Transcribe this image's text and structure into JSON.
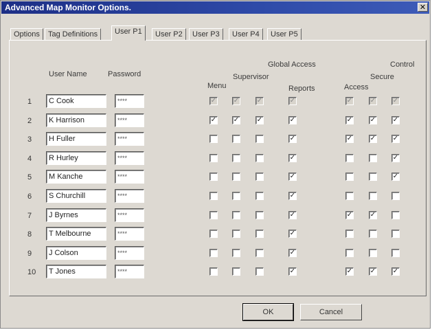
{
  "window": {
    "title": "Advanced Map Monitor Options."
  },
  "tabs": [
    "Options",
    "Tag Definitions",
    "User P1",
    "User P2",
    "User P3",
    "User P4",
    "User P5"
  ],
  "active_tab": "User P1",
  "headers": {
    "user_name": "User Name",
    "password": "Password",
    "global_access": "Global Access",
    "supervisor": "Supervisor",
    "menu": "Menu",
    "reports": "Reports",
    "control": "Control",
    "secure": "Secure",
    "access": "Access"
  },
  "rows": [
    {
      "num": "1",
      "name": "C Cook",
      "password": "****",
      "checks": [
        1,
        1,
        1,
        1,
        1,
        1,
        1
      ],
      "disabled": true
    },
    {
      "num": "2",
      "name": "K Harrison",
      "password": "****",
      "checks": [
        1,
        1,
        1,
        1,
        1,
        1,
        1
      ],
      "disabled": false
    },
    {
      "num": "3",
      "name": "H Fuller",
      "password": "****",
      "checks": [
        0,
        0,
        0,
        1,
        1,
        1,
        1
      ],
      "disabled": false
    },
    {
      "num": "4",
      "name": "R Hurley",
      "password": "****",
      "checks": [
        0,
        0,
        0,
        1,
        0,
        0,
        1
      ],
      "disabled": false
    },
    {
      "num": "5",
      "name": "M Kanche",
      "password": "****",
      "checks": [
        0,
        0,
        0,
        1,
        0,
        0,
        1
      ],
      "disabled": false
    },
    {
      "num": "6",
      "name": "S Churchill",
      "password": "****",
      "checks": [
        0,
        0,
        0,
        1,
        0,
        0,
        0
      ],
      "disabled": false
    },
    {
      "num": "7",
      "name": "J Byrnes",
      "password": "****",
      "checks": [
        0,
        0,
        0,
        1,
        1,
        1,
        0
      ],
      "disabled": false
    },
    {
      "num": "8",
      "name": "T Melbourne",
      "password": "****",
      "checks": [
        0,
        0,
        0,
        1,
        0,
        0,
        0
      ],
      "disabled": false
    },
    {
      "num": "9",
      "name": "J Colson",
      "password": "****",
      "checks": [
        0,
        0,
        0,
        1,
        0,
        0,
        0
      ],
      "disabled": false
    },
    {
      "num": "10",
      "name": "T Jones",
      "password": "****",
      "checks": [
        0,
        0,
        0,
        1,
        1,
        1,
        1
      ],
      "disabled": false
    }
  ],
  "buttons": {
    "ok": "OK",
    "cancel": "Cancel"
  },
  "colors": {
    "title_bar": "#1d2f86",
    "dialog_bg": "#ddd9d2"
  }
}
